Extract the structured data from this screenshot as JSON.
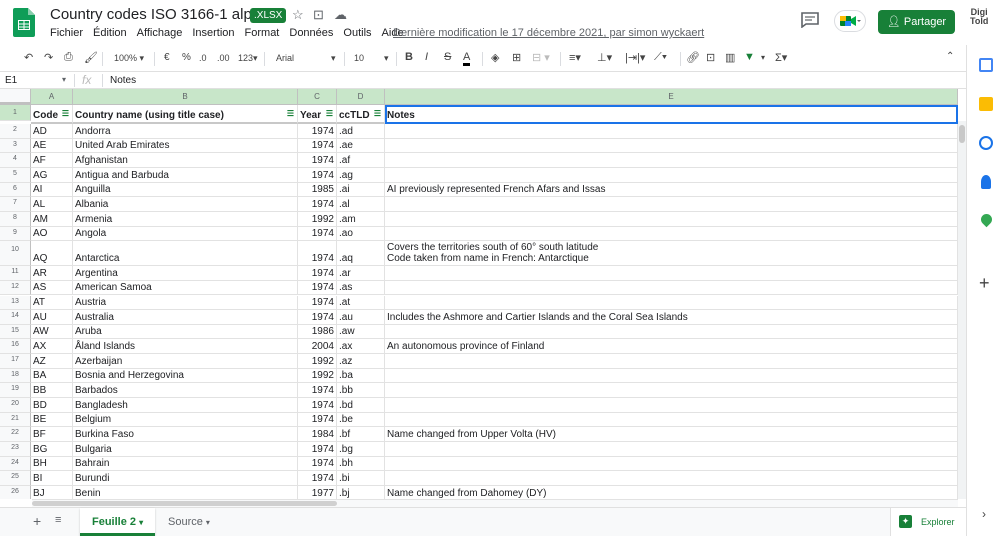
{
  "header": {
    "title": "Country codes ISO 3166-1 alpha-2",
    "badge": ".XLSX",
    "menu": [
      "Fichier",
      "Édition",
      "Affichage",
      "Insertion",
      "Format",
      "Données",
      "Outils",
      "Aide"
    ],
    "last_edit": "Dernière modification le 17 décembre 2021, par simon wyckaert",
    "share_label": "Partager",
    "brand_line1": "Digi",
    "brand_line2": "Told"
  },
  "toolbar": {
    "zoom": "100%",
    "currency": "€",
    "percent": "%",
    "dec_less": ".0",
    "dec_more": ".00",
    "format_num": "123",
    "font": "Arial",
    "font_size": "10",
    "bold": "B",
    "italic": "I",
    "strike": "S",
    "text_color": "A"
  },
  "formula_bar": {
    "cell_ref": "E1",
    "fx": "fx",
    "value": "Notes"
  },
  "columns": [
    "A",
    "B",
    "C",
    "D",
    "E"
  ],
  "headers": [
    "Code",
    "Country name (using title case)",
    "Year",
    "ccTLD",
    "Notes"
  ],
  "rows": [
    {
      "n": "2",
      "code": "AD",
      "name": "Andorra",
      "year": "1974",
      "tld": ".ad",
      "notes": ""
    },
    {
      "n": "3",
      "code": "AE",
      "name": "United Arab Emirates",
      "year": "1974",
      "tld": ".ae",
      "notes": ""
    },
    {
      "n": "4",
      "code": "AF",
      "name": "Afghanistan",
      "year": "1974",
      "tld": ".af",
      "notes": ""
    },
    {
      "n": "5",
      "code": "AG",
      "name": "Antigua and Barbuda",
      "year": "1974",
      "tld": ".ag",
      "notes": ""
    },
    {
      "n": "6",
      "code": "AI",
      "name": "Anguilla",
      "year": "1985",
      "tld": ".ai",
      "notes": "AI previously represented French Afars and Issas"
    },
    {
      "n": "7",
      "code": "AL",
      "name": "Albania",
      "year": "1974",
      "tld": ".al",
      "notes": ""
    },
    {
      "n": "8",
      "code": "AM",
      "name": "Armenia",
      "year": "1992",
      "tld": ".am",
      "notes": ""
    },
    {
      "n": "9",
      "code": "AO",
      "name": "Angola",
      "year": "1974",
      "tld": ".ao",
      "notes": ""
    },
    {
      "n": "10",
      "code": "AQ",
      "name": "Antarctica",
      "year": "1974",
      "tld": ".aq",
      "notes": "Covers the territories south of 60° south latitude\nCode taken from name in French: Antarctique"
    },
    {
      "n": "11",
      "code": "AR",
      "name": "Argentina",
      "year": "1974",
      "tld": ".ar",
      "notes": ""
    },
    {
      "n": "12",
      "code": "AS",
      "name": "American Samoa",
      "year": "1974",
      "tld": ".as",
      "notes": ""
    },
    {
      "n": "13",
      "code": "AT",
      "name": "Austria",
      "year": "1974",
      "tld": ".at",
      "notes": ""
    },
    {
      "n": "14",
      "code": "AU",
      "name": "Australia",
      "year": "1974",
      "tld": ".au",
      "notes": "Includes the Ashmore and Cartier Islands and the Coral Sea Islands"
    },
    {
      "n": "15",
      "code": "AW",
      "name": "Aruba",
      "year": "1986",
      "tld": ".aw",
      "notes": ""
    },
    {
      "n": "16",
      "code": "AX",
      "name": "Åland Islands",
      "year": "2004",
      "tld": ".ax",
      "notes": "An autonomous province of Finland"
    },
    {
      "n": "17",
      "code": "AZ",
      "name": "Azerbaijan",
      "year": "1992",
      "tld": ".az",
      "notes": ""
    },
    {
      "n": "18",
      "code": "BA",
      "name": "Bosnia and Herzegovina",
      "year": "1992",
      "tld": ".ba",
      "notes": ""
    },
    {
      "n": "19",
      "code": "BB",
      "name": "Barbados",
      "year": "1974",
      "tld": ".bb",
      "notes": ""
    },
    {
      "n": "20",
      "code": "BD",
      "name": "Bangladesh",
      "year": "1974",
      "tld": ".bd",
      "notes": ""
    },
    {
      "n": "21",
      "code": "BE",
      "name": "Belgium",
      "year": "1974",
      "tld": ".be",
      "notes": ""
    },
    {
      "n": "22",
      "code": "BF",
      "name": "Burkina Faso",
      "year": "1984",
      "tld": ".bf",
      "notes": "Name changed from Upper Volta (HV)"
    },
    {
      "n": "23",
      "code": "BG",
      "name": "Bulgaria",
      "year": "1974",
      "tld": ".bg",
      "notes": ""
    },
    {
      "n": "24",
      "code": "BH",
      "name": "Bahrain",
      "year": "1974",
      "tld": ".bh",
      "notes": ""
    },
    {
      "n": "25",
      "code": "BI",
      "name": "Burundi",
      "year": "1974",
      "tld": ".bi",
      "notes": ""
    },
    {
      "n": "26",
      "code": "BJ",
      "name": "Benin",
      "year": "1977",
      "tld": ".bj",
      "notes": "Name changed from Dahomey (DY)"
    }
  ],
  "sheets": {
    "add": "+",
    "all": "≡",
    "tabs": [
      "Feuille 2",
      "Source"
    ],
    "explore": "Explorer"
  },
  "colors": {
    "accent": "#188038",
    "selection": "#1a73e8",
    "header_bg": "#c8e6c9"
  }
}
